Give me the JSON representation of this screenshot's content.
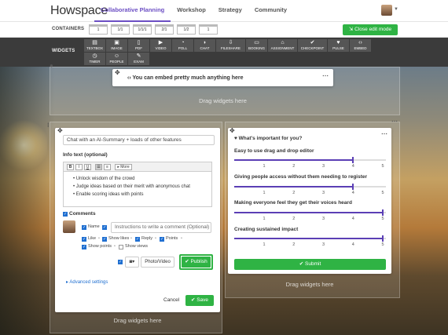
{
  "app": {
    "logo": "Howspace"
  },
  "nav": {
    "tabs": [
      {
        "label": "Collaborative Planning",
        "active": true
      },
      {
        "label": "Workshop",
        "active": false
      },
      {
        "label": "Strategy",
        "active": false
      },
      {
        "label": "Community",
        "active": false
      }
    ]
  },
  "containers": {
    "label": "CONTAINERS",
    "layouts": [
      "1",
      "1/1",
      "1/1/1",
      "2/1",
      "1/2",
      "1"
    ],
    "close_edit_label": "Close edit mode"
  },
  "widgets": {
    "label": "WIDGETS",
    "items": [
      {
        "label": "TEXTBOX",
        "icon": "textbox-icon"
      },
      {
        "label": "IMAGE",
        "icon": "image-icon"
      },
      {
        "label": "PDF",
        "icon": "pdf-icon"
      },
      {
        "label": "VIDEO",
        "icon": "video-icon"
      },
      {
        "label": "POLL",
        "icon": "poll-icon"
      },
      {
        "label": "CHAT",
        "icon": "chat-icon"
      },
      {
        "label": "FILESHARE",
        "icon": "fileshare-icon"
      },
      {
        "label": "BOOKING",
        "icon": "booking-icon"
      },
      {
        "label": "ASSIGNMENT",
        "icon": "assignment-icon"
      },
      {
        "label": "CHECKPOINT",
        "icon": "checkpoint-icon"
      },
      {
        "label": "PULSE",
        "icon": "pulse-icon"
      },
      {
        "label": "EMBED",
        "icon": "embed-icon"
      },
      {
        "label": "TIMER",
        "icon": "timer-icon"
      },
      {
        "label": "PEOPLE",
        "icon": "people-icon"
      },
      {
        "label": "EXAM",
        "icon": "exam-icon"
      }
    ]
  },
  "embed_card": {
    "text": "You can embed pretty much anything here",
    "drag_hint": "Drag widgets here"
  },
  "chat_card": {
    "title_value": "Chat with an AI-Summary + loads of other features",
    "info_label": "Info text (optional)",
    "more_label": "More",
    "bullets": [
      "Unlock wisdom of the crowd",
      "Judge ideas based on their merit with anonymous chat",
      "Enable scoring ideas with points"
    ],
    "comments_label": "Comments",
    "comment_placeholder": "Instructions to write a comment (Optional)",
    "name_label": "Name",
    "options_row1": [
      "Like",
      "Show likes",
      "Reply",
      "Points"
    ],
    "options_row2": [
      "Show points",
      "Show views"
    ],
    "photo_video_label": "Photo/Video",
    "publish_label": "Publish",
    "advanced_label": "Advanced settings",
    "cancel_label": "Cancel",
    "save_label": "Save",
    "drag_hint": "Drag widgets here"
  },
  "survey_card": {
    "title": "What's important for you?",
    "questions": [
      {
        "text": "Easy to use drag and drop editor",
        "value": 4
      },
      {
        "text": "Giving people access without them needing to register",
        "value": 4
      },
      {
        "text": "Making everyone feel they get their voices heard",
        "value": 5
      },
      {
        "text": "Creating sustained impact",
        "value": 5
      }
    ],
    "scale": [
      "1",
      "2",
      "3",
      "4",
      "5"
    ],
    "submit_label": "Submit",
    "drag_hint": "Drag widgets here"
  },
  "colors": {
    "accent": "#6c4fc4",
    "green": "#2fb344",
    "slider": "#5b3fb5",
    "toolbar": "#3b3b3b"
  }
}
